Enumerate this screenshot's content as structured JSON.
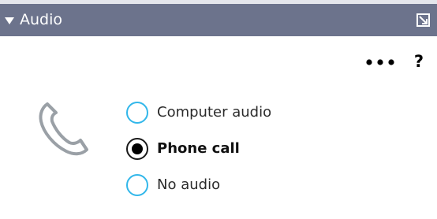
{
  "panel": {
    "title": "Audio",
    "collapse_icon": "triangle-down-icon",
    "popout_icon": "popout-window-icon",
    "colors": {
      "titlebar": "#6c738c",
      "radio_border": "#32b7ea",
      "phone_icon": "#9aa0a6"
    }
  },
  "toolbar": {
    "more_icon": "ellipsis-icon",
    "help_label": "?"
  },
  "audio": {
    "icon": "phone-handset-icon",
    "selected": "Phone call",
    "options": [
      {
        "label": "Computer audio",
        "selected": false
      },
      {
        "label": "Phone call",
        "selected": true
      },
      {
        "label": "No audio",
        "selected": false
      }
    ]
  }
}
